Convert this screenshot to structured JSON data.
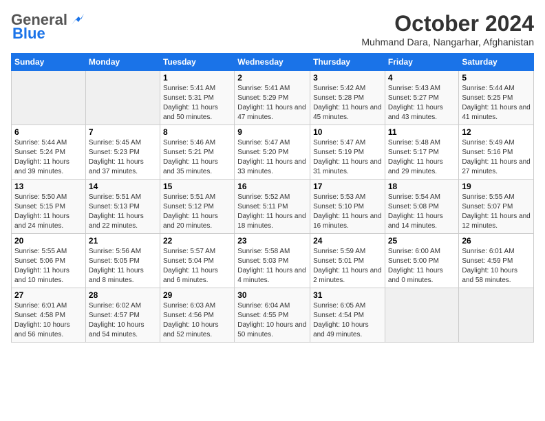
{
  "header": {
    "logo_general": "General",
    "logo_blue": "Blue",
    "title": "October 2024",
    "location": "Muhmand Dara, Nangarhar, Afghanistan"
  },
  "days_of_week": [
    "Sunday",
    "Monday",
    "Tuesday",
    "Wednesday",
    "Thursday",
    "Friday",
    "Saturday"
  ],
  "weeks": [
    [
      {
        "num": "",
        "info": ""
      },
      {
        "num": "",
        "info": ""
      },
      {
        "num": "1",
        "info": "Sunrise: 5:41 AM\nSunset: 5:31 PM\nDaylight: 11 hours and 50 minutes."
      },
      {
        "num": "2",
        "info": "Sunrise: 5:41 AM\nSunset: 5:29 PM\nDaylight: 11 hours and 47 minutes."
      },
      {
        "num": "3",
        "info": "Sunrise: 5:42 AM\nSunset: 5:28 PM\nDaylight: 11 hours and 45 minutes."
      },
      {
        "num": "4",
        "info": "Sunrise: 5:43 AM\nSunset: 5:27 PM\nDaylight: 11 hours and 43 minutes."
      },
      {
        "num": "5",
        "info": "Sunrise: 5:44 AM\nSunset: 5:25 PM\nDaylight: 11 hours and 41 minutes."
      }
    ],
    [
      {
        "num": "6",
        "info": "Sunrise: 5:44 AM\nSunset: 5:24 PM\nDaylight: 11 hours and 39 minutes."
      },
      {
        "num": "7",
        "info": "Sunrise: 5:45 AM\nSunset: 5:23 PM\nDaylight: 11 hours and 37 minutes."
      },
      {
        "num": "8",
        "info": "Sunrise: 5:46 AM\nSunset: 5:21 PM\nDaylight: 11 hours and 35 minutes."
      },
      {
        "num": "9",
        "info": "Sunrise: 5:47 AM\nSunset: 5:20 PM\nDaylight: 11 hours and 33 minutes."
      },
      {
        "num": "10",
        "info": "Sunrise: 5:47 AM\nSunset: 5:19 PM\nDaylight: 11 hours and 31 minutes."
      },
      {
        "num": "11",
        "info": "Sunrise: 5:48 AM\nSunset: 5:17 PM\nDaylight: 11 hours and 29 minutes."
      },
      {
        "num": "12",
        "info": "Sunrise: 5:49 AM\nSunset: 5:16 PM\nDaylight: 11 hours and 27 minutes."
      }
    ],
    [
      {
        "num": "13",
        "info": "Sunrise: 5:50 AM\nSunset: 5:15 PM\nDaylight: 11 hours and 24 minutes."
      },
      {
        "num": "14",
        "info": "Sunrise: 5:51 AM\nSunset: 5:13 PM\nDaylight: 11 hours and 22 minutes."
      },
      {
        "num": "15",
        "info": "Sunrise: 5:51 AM\nSunset: 5:12 PM\nDaylight: 11 hours and 20 minutes."
      },
      {
        "num": "16",
        "info": "Sunrise: 5:52 AM\nSunset: 5:11 PM\nDaylight: 11 hours and 18 minutes."
      },
      {
        "num": "17",
        "info": "Sunrise: 5:53 AM\nSunset: 5:10 PM\nDaylight: 11 hours and 16 minutes."
      },
      {
        "num": "18",
        "info": "Sunrise: 5:54 AM\nSunset: 5:08 PM\nDaylight: 11 hours and 14 minutes."
      },
      {
        "num": "19",
        "info": "Sunrise: 5:55 AM\nSunset: 5:07 PM\nDaylight: 11 hours and 12 minutes."
      }
    ],
    [
      {
        "num": "20",
        "info": "Sunrise: 5:55 AM\nSunset: 5:06 PM\nDaylight: 11 hours and 10 minutes."
      },
      {
        "num": "21",
        "info": "Sunrise: 5:56 AM\nSunset: 5:05 PM\nDaylight: 11 hours and 8 minutes."
      },
      {
        "num": "22",
        "info": "Sunrise: 5:57 AM\nSunset: 5:04 PM\nDaylight: 11 hours and 6 minutes."
      },
      {
        "num": "23",
        "info": "Sunrise: 5:58 AM\nSunset: 5:03 PM\nDaylight: 11 hours and 4 minutes."
      },
      {
        "num": "24",
        "info": "Sunrise: 5:59 AM\nSunset: 5:01 PM\nDaylight: 11 hours and 2 minutes."
      },
      {
        "num": "25",
        "info": "Sunrise: 6:00 AM\nSunset: 5:00 PM\nDaylight: 11 hours and 0 minutes."
      },
      {
        "num": "26",
        "info": "Sunrise: 6:01 AM\nSunset: 4:59 PM\nDaylight: 10 hours and 58 minutes."
      }
    ],
    [
      {
        "num": "27",
        "info": "Sunrise: 6:01 AM\nSunset: 4:58 PM\nDaylight: 10 hours and 56 minutes."
      },
      {
        "num": "28",
        "info": "Sunrise: 6:02 AM\nSunset: 4:57 PM\nDaylight: 10 hours and 54 minutes."
      },
      {
        "num": "29",
        "info": "Sunrise: 6:03 AM\nSunset: 4:56 PM\nDaylight: 10 hours and 52 minutes."
      },
      {
        "num": "30",
        "info": "Sunrise: 6:04 AM\nSunset: 4:55 PM\nDaylight: 10 hours and 50 minutes."
      },
      {
        "num": "31",
        "info": "Sunrise: 6:05 AM\nSunset: 4:54 PM\nDaylight: 10 hours and 49 minutes."
      },
      {
        "num": "",
        "info": ""
      },
      {
        "num": "",
        "info": ""
      }
    ]
  ]
}
